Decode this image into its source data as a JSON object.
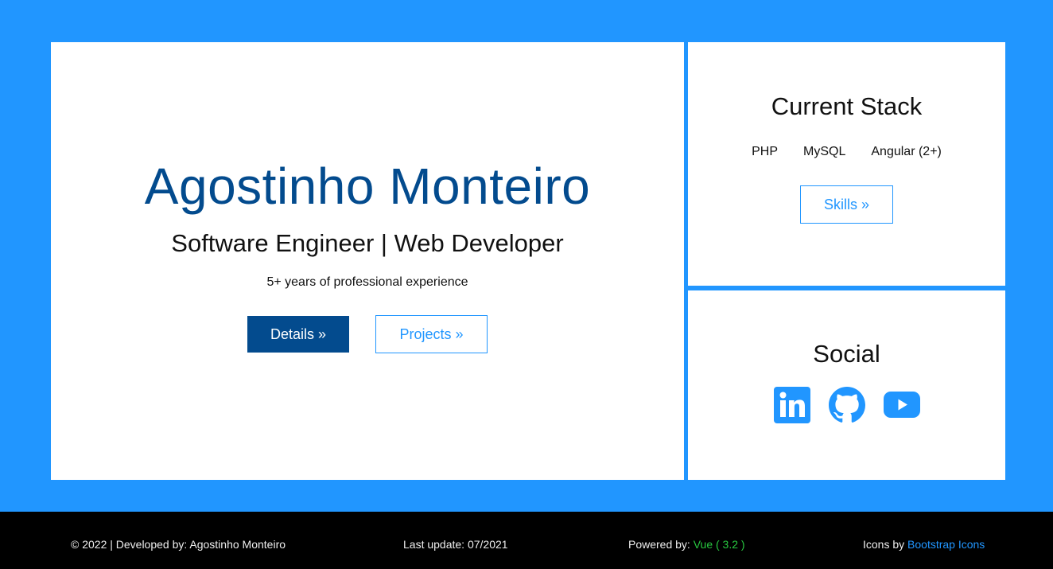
{
  "hero": {
    "name": "Agostinho Monteiro",
    "role": "Software Engineer | Web Developer",
    "experience": "5+ years of professional experience",
    "details_button": "Details »",
    "projects_button": "Projects »"
  },
  "stack": {
    "title": "Current Stack",
    "items": [
      "PHP",
      "MySQL",
      "Angular (2+)"
    ],
    "skills_button": "Skills »"
  },
  "social": {
    "title": "Social",
    "icons": [
      "linkedin-icon",
      "github-icon",
      "youtube-icon"
    ]
  },
  "footer": {
    "copyright": "© 2022 | Developed by: Agostinho Monteiro",
    "last_update": "Last update: 07/2021",
    "powered_label": "Powered by: ",
    "powered_value": "Vue ( 3.2 )",
    "icons_label": "Icons by ",
    "icons_link": "Bootstrap Icons"
  },
  "colors": {
    "background": "#2196ff",
    "primary": "#034b8e",
    "accent": "#2196ff",
    "vue": "#28c940"
  }
}
